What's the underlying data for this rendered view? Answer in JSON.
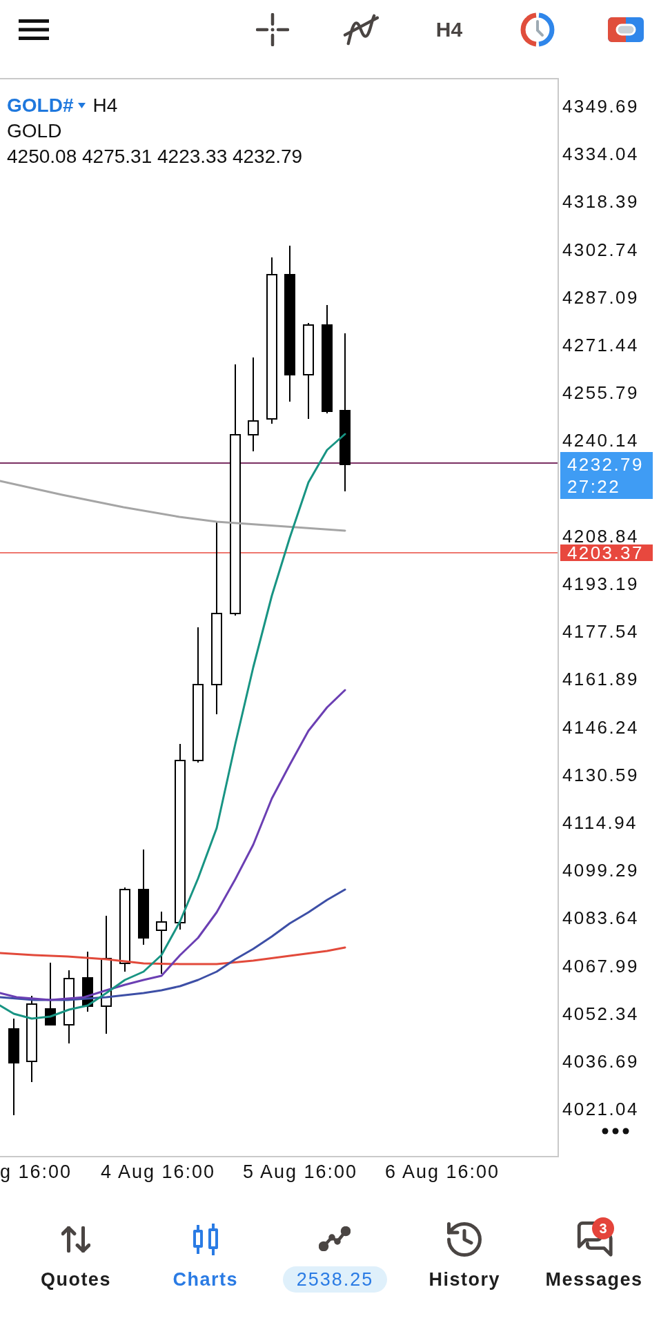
{
  "toolbar": {
    "timeframe": "H4"
  },
  "chart": {
    "symbol": "GOLD#",
    "timeframe": "H4",
    "description": "GOLD",
    "ohlc": "4250.08 4275.31 4223.33 4232.79",
    "price_axis": [
      "4349.69",
      "4334.04",
      "4318.39",
      "4302.74",
      "4287.09",
      "4271.44",
      "4255.79",
      "4240.14",
      "4208.84",
      "4193.19",
      "4177.54",
      "4161.89",
      "4146.24",
      "4130.59",
      "4114.94",
      "4099.29",
      "4083.64",
      "4067.99",
      "4052.34",
      "4036.69",
      "4021.04"
    ],
    "price_tags": [
      {
        "kind": "bid",
        "price": "4232.79",
        "countdown": "27:22",
        "color": "#3f9cf4"
      },
      {
        "kind": "level",
        "price": "4203.37",
        "color": "#e8483e"
      }
    ],
    "time_axis": [
      "g 16:00",
      "4 Aug 16:00",
      "5 Aug 16:00",
      "6 Aug 16:00"
    ]
  },
  "nav": {
    "items": [
      {
        "kind": "tab",
        "label": "Quotes",
        "selected": false
      },
      {
        "kind": "tab",
        "label": "Charts",
        "selected": true
      },
      {
        "kind": "balance",
        "label": "2538.25",
        "selected": false
      },
      {
        "kind": "tab",
        "label": "History",
        "selected": false
      },
      {
        "kind": "tab",
        "label": "Messages",
        "selected": false,
        "badge": "3"
      }
    ]
  }
}
